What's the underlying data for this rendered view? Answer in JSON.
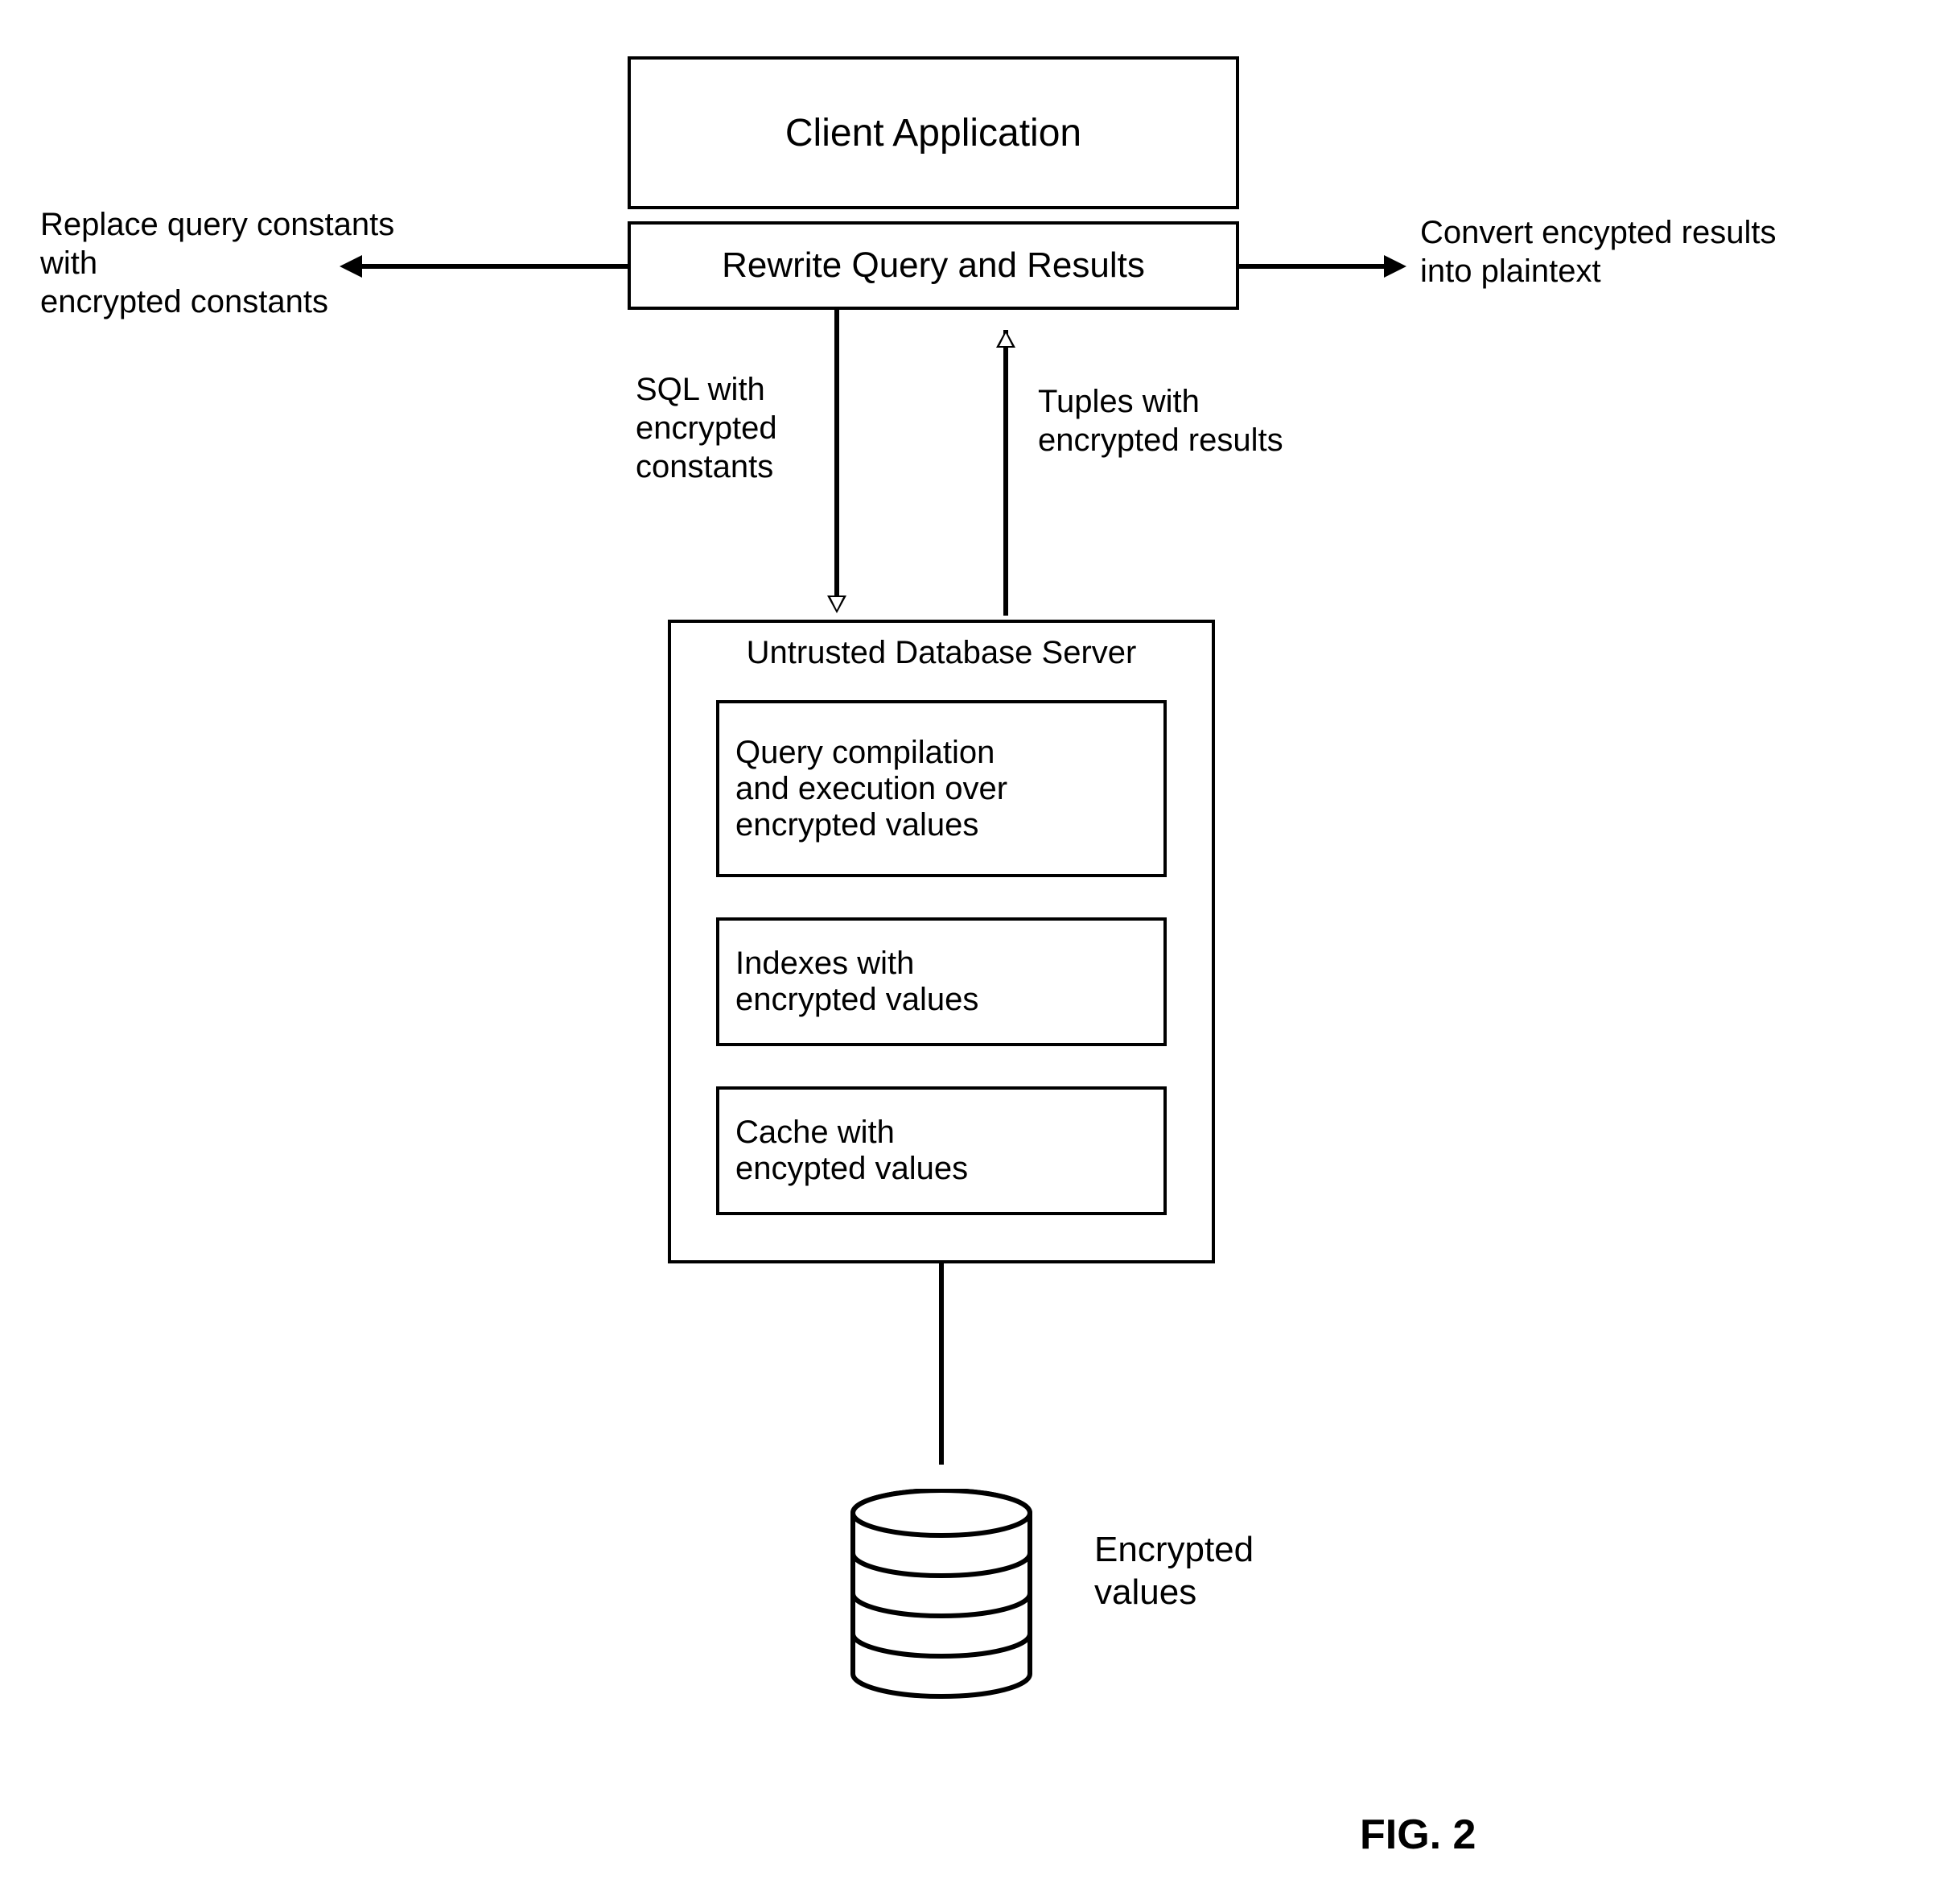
{
  "client_box": "Client Application",
  "rewrite_box": "Rewrite Query and Results",
  "left_annotation_line1": "Replace query constants",
  "left_annotation_line2": "with",
  "left_annotation_line3": "encrypted constants",
  "right_annotation_line1": "Convert encypted results",
  "right_annotation_line2": "into plaintext",
  "sql_label_line1": "SQL with",
  "sql_label_line2": "encrypted",
  "sql_label_line3": "constants",
  "tuples_label_line1": "Tuples with",
  "tuples_label_line2": "encrypted results",
  "server_title": "Untrusted Database Server",
  "server_box1_line1": "Query compilation",
  "server_box1_line2": "and execution over",
  "server_box1_line3": "encrypted values",
  "server_box2_line1": "Indexes with",
  "server_box2_line2": "encrypted values",
  "server_box3_line1": "Cache with",
  "server_box3_line2": "encypted values",
  "storage_label_line1": "Encrypted",
  "storage_label_line2": "values",
  "figure_label": "FIG. 2"
}
